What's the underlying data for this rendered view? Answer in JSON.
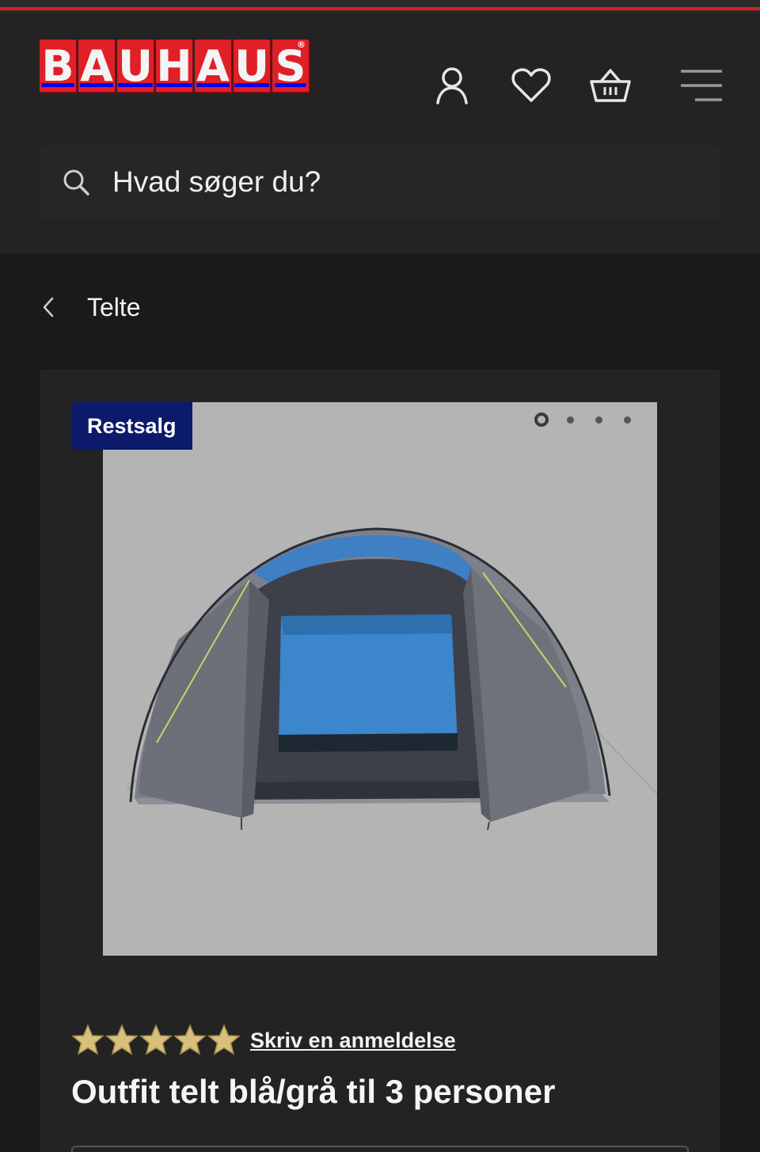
{
  "header": {
    "logo_letters": [
      "B",
      "A",
      "U",
      "H",
      "A",
      "U",
      "S"
    ],
    "logo_reg": "®",
    "icons": [
      "account-icon",
      "heart-icon",
      "basket-icon",
      "menu-icon"
    ]
  },
  "search": {
    "placeholder": "Hvad søger du?"
  },
  "breadcrumb": {
    "label": "Telte"
  },
  "product": {
    "badge": "Restsalg",
    "gallery_dots": 4,
    "gallery_active_index": 0,
    "rating_stars": 5,
    "review_link": "Skriv en anmeldelse",
    "title": "Outfit telt blå/grå til 3 personer"
  },
  "colors": {
    "brand_red": "#e01f26",
    "badge_blue": "#0c1a6b",
    "star_gold": "#d9c07a"
  }
}
